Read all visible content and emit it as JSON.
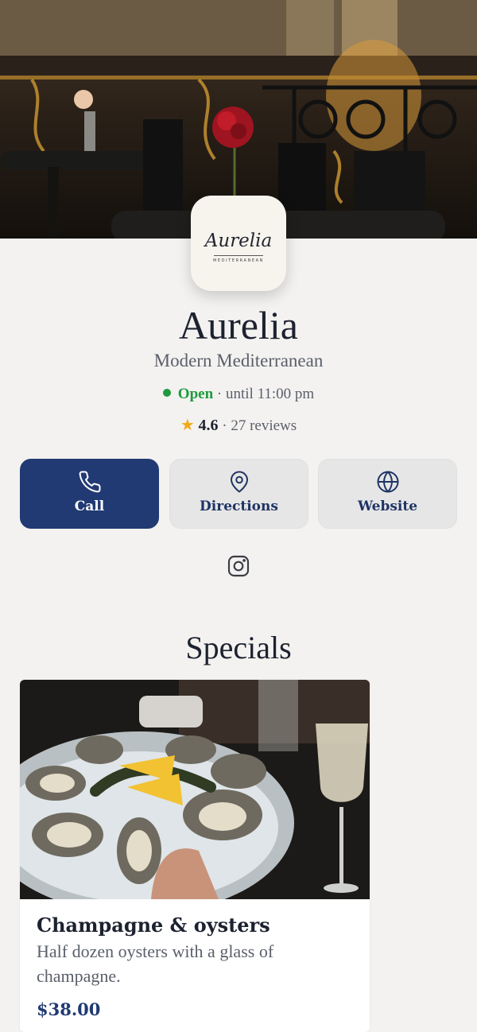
{
  "restaurant": {
    "logo_word": "Aurelia",
    "logo_sub": "MEDITERRANEAN",
    "name": "Aurelia",
    "cuisine": "Modern Mediterranean",
    "status": "Open",
    "hours": " · until 11:00 pm",
    "rating": "4.6",
    "reviews": " · 27 reviews"
  },
  "actions": {
    "call": "Call",
    "directions": "Directions",
    "website": "Website"
  },
  "specials": {
    "title": "Specials",
    "items": [
      {
        "title": "Champagne & oysters",
        "description": "Half dozen oysters with a glass of champagne.",
        "price": "$38.00"
      }
    ]
  },
  "colors": {
    "accent": "#213a73",
    "open_green": "#1e9a3f",
    "star": "#f2a916",
    "background": "#f3f2f0"
  },
  "icons": [
    "phone-icon",
    "map-pin-icon",
    "globe-icon",
    "instagram-icon",
    "star-icon",
    "status-dot-icon"
  ]
}
